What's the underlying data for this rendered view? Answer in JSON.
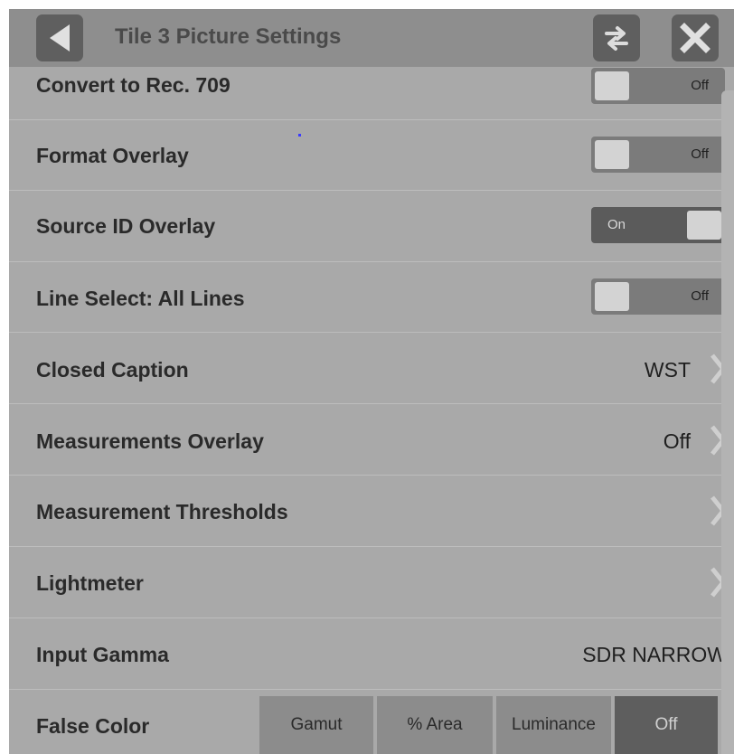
{
  "header": {
    "title": "Tile 3 Picture Settings",
    "back_icon": "back-triangle-icon",
    "swap_icon": "swap-arrows-icon",
    "close_icon": "close-x-icon"
  },
  "settings": {
    "convert_rec709": {
      "label": "Convert to Rec. 709",
      "state": "Off"
    },
    "format_overlay": {
      "label": "Format Overlay",
      "state": "Off"
    },
    "source_id_overlay": {
      "label": "Source ID Overlay",
      "state": "On"
    },
    "line_select": {
      "label": "Line Select: All Lines",
      "state": "Off"
    },
    "closed_caption": {
      "label": "Closed Caption",
      "value": "WST"
    },
    "measurements_overlay": {
      "label": "Measurements Overlay",
      "value": "Off"
    },
    "measurement_thresholds": {
      "label": "Measurement Thresholds"
    },
    "lightmeter": {
      "label": "Lightmeter"
    },
    "input_gamma": {
      "label": "Input Gamma",
      "value": "SDR NARROW"
    },
    "false_color": {
      "label": "False Color",
      "options": [
        "Gamut",
        "% Area",
        "Luminance",
        "Off"
      ],
      "selected": "Off"
    }
  },
  "colors": {
    "panel": "#a9a9a9",
    "header": "#8e8e8e",
    "button": "#5f5f5f",
    "toggle_off": "#7b7b7b",
    "toggle_on": "#5b5b5b"
  }
}
